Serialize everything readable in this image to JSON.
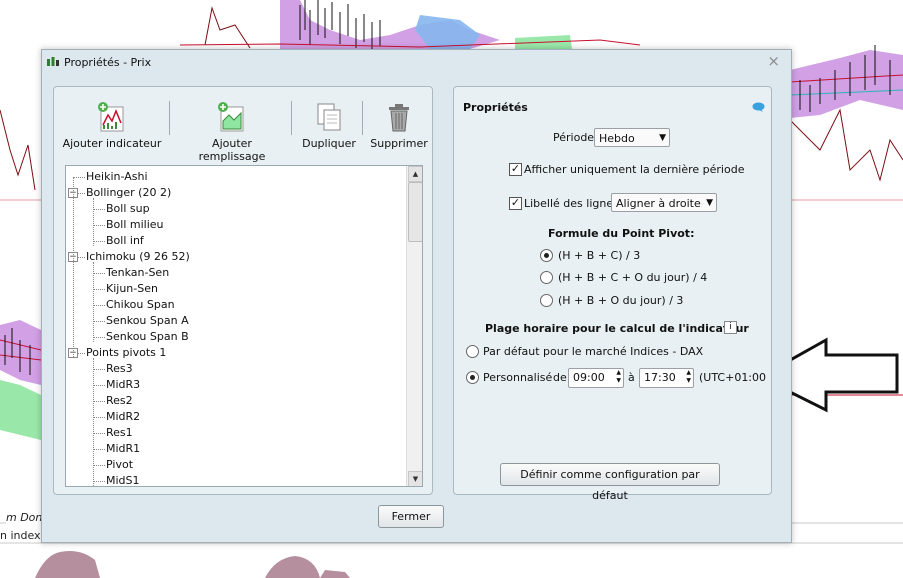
{
  "background": {
    "label_1": "m Donne",
    "label_2": "n index ("
  },
  "dialog": {
    "title": "Propriétés - Prix",
    "close_glyph": "×",
    "close_label": "Fermer"
  },
  "toolbar": {
    "add_indicator": "Ajouter indicateur",
    "add_fill": "Ajouter remplissage",
    "duplicate": "Dupliquer",
    "delete": "Supprimer"
  },
  "tree": {
    "items": [
      {
        "label": "Heikin-Ashi",
        "level": 0,
        "expander": ""
      },
      {
        "label": "Bollinger (20 2)",
        "level": 0,
        "expander": "−"
      },
      {
        "label": "Boll sup",
        "level": 1,
        "expander": ""
      },
      {
        "label": "Boll milieu",
        "level": 1,
        "expander": ""
      },
      {
        "label": "Boll inf",
        "level": 1,
        "expander": ""
      },
      {
        "label": "Ichimoku (9 26 52)",
        "level": 0,
        "expander": "−"
      },
      {
        "label": "Tenkan-Sen",
        "level": 1,
        "expander": ""
      },
      {
        "label": "Kijun-Sen",
        "level": 1,
        "expander": ""
      },
      {
        "label": "Chikou Span",
        "level": 1,
        "expander": ""
      },
      {
        "label": "Senkou Span A",
        "level": 1,
        "expander": ""
      },
      {
        "label": "Senkou Span B",
        "level": 1,
        "expander": ""
      },
      {
        "label": "Points pivots 1",
        "level": 0,
        "expander": "−"
      },
      {
        "label": "Res3",
        "level": 1,
        "expander": ""
      },
      {
        "label": "MidR3",
        "level": 1,
        "expander": ""
      },
      {
        "label": "Res2",
        "level": 1,
        "expander": ""
      },
      {
        "label": "MidR2",
        "level": 1,
        "expander": ""
      },
      {
        "label": "Res1",
        "level": 1,
        "expander": ""
      },
      {
        "label": "MidR1",
        "level": 1,
        "expander": ""
      },
      {
        "label": "Pivot",
        "level": 1,
        "expander": ""
      },
      {
        "label": "MidS1",
        "level": 1,
        "expander": ""
      }
    ]
  },
  "properties": {
    "title": "Propriétés",
    "period_label": "Période",
    "period_value": "Hebdo",
    "show_last_period": "Afficher uniquement la dernière période",
    "show_last_period_checked": true,
    "line_labels": "Libellé des lignes",
    "line_labels_checked": true,
    "line_labels_align": "Aligner à droite",
    "pivot_formula_title": "Formule du Point Pivot:",
    "formulas": [
      {
        "label": "(H + B + C) / 3",
        "selected": true
      },
      {
        "label": "(H + B + C + O du jour) / 4",
        "selected": false
      },
      {
        "label": "(H + B + O du jour) / 3",
        "selected": false
      }
    ],
    "time_range_title": "Plage horaire pour le calcul de l'indicateur",
    "info_glyph": "i",
    "default_market": "Par défaut pour le marché Indices - DAX",
    "default_market_selected": false,
    "custom": "Personnalisé",
    "custom_selected": true,
    "from_label": "de",
    "from_value": "09:00",
    "to_label": "à",
    "to_value": "17:30",
    "timezone": "(UTC+01:00",
    "set_default": "Définir comme configuration par défaut"
  },
  "colors": {
    "dialog_bg": "#dde8ee",
    "cloud_purple": "#c98fe0",
    "cloud_green": "#8ee6a0",
    "cloud_blue": "#86b6ee",
    "line_red": "#c8102e",
    "line_darkred": "#7a0e14"
  }
}
